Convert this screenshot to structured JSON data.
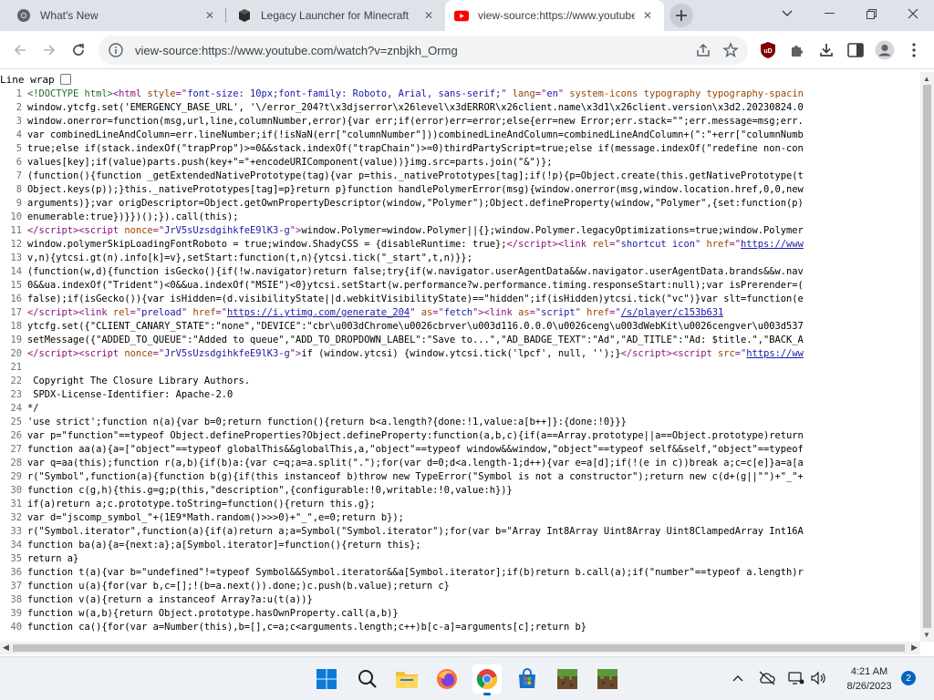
{
  "colors": {
    "accent": "#0067c0",
    "tabstrip": "#dee3ea",
    "source_text": "#000000",
    "tag": "#881280",
    "attr": "#994500",
    "value": "#1a1aa6",
    "comment": "#236e25"
  },
  "browser": {
    "tabs": [
      {
        "label": "What's New",
        "favicon": "chrome-logo-icon",
        "active": false
      },
      {
        "label": "Legacy Launcher for Minecraft",
        "favicon": "legacy-launcher-icon",
        "active": false
      },
      {
        "label": "view-source:https://www.youtube",
        "favicon": "youtube-logo-icon",
        "active": true
      }
    ],
    "address": "view-source:https://www.youtube.com/watch?v=znbjkh_Ormg"
  },
  "source_view": {
    "line_wrap_label": "Line wrap",
    "lines": [
      {
        "n": "1",
        "html": "<span class=\"t-comment\">&lt;!DOCTYPE html&gt;</span><span class=\"t-tag\">&lt;html </span><span class=\"t-attr\">style</span><span class=\"t-tag\">=\"</span><span class=\"t-val\">font-size: 10px;font-family: Roboto, Arial, sans-serif;</span><span class=\"t-tag\">\" </span><span class=\"t-attr\">lang</span><span class=\"t-tag\">=\"</span><span class=\"t-val\">en</span><span class=\"t-tag\">\" </span><span class=\"t-attr\">system-icons typography typography-spacin</span>"
      },
      {
        "n": "2",
        "text": "window.ytcfg.set('EMERGENCY_BASE_URL', '\\/error_204?t\\x3djserror\\x26level\\x3dERROR\\x26client.name\\x3d1\\x26client.version\\x3d2.20230824.0"
      },
      {
        "n": "3",
        "text": "window.onerror=function(msg,url,line,columnNumber,error){var err;if(error)err=error;else{err=new Error;err.stack=\"\";err.message=msg;err."
      },
      {
        "n": "4",
        "text": "var combinedLineAndColumn=err.lineNumber;if(!isNaN(err[\"columnNumber\"]))combinedLineAndColumn=combinedLineAndColumn+(\":\"+err[\"columnNumb"
      },
      {
        "n": "5",
        "text": "true;else if(stack.indexOf(\"trapProp\")>=0&&stack.indexOf(\"trapChain\")>=0)thirdPartyScript=true;else if(message.indexOf(\"redefine non-con"
      },
      {
        "n": "6",
        "text": "values[key];if(value)parts.push(key+\"=\"+encodeURIComponent(value))}img.src=parts.join(\"&\")};"
      },
      {
        "n": "7",
        "text": "(function(){function _getExtendedNativePrototype(tag){var p=this._nativePrototypes[tag];if(!p){p=Object.create(this.getNativePrototype(t"
      },
      {
        "n": "8",
        "text": "Object.keys(p));}this._nativePrototypes[tag]=p}return p}function handlePolymerError(msg){window.onerror(msg,window.location.href,0,0,new"
      },
      {
        "n": "9",
        "text": "arguments)};var origDescriptor=Object.getOwnPropertyDescriptor(window,\"Polymer\");Object.defineProperty(window,\"Polymer\",{set:function(p)"
      },
      {
        "n": "10",
        "text": "enumerable:true})}})();}).call(this);"
      },
      {
        "n": "11",
        "html": "<span class=\"t-tag\">&lt;/script&gt;&lt;script </span><span class=\"t-attr\">nonce</span><span class=\"t-tag\">=\"</span><span class=\"t-val\">JrV5sUzsdgihkfeE9lK3-g</span><span class=\"t-tag\">\"&gt;</span>window.Polymer=window.Polymer||{};window.Polymer.legacyOptimizations=true;window.Polymer"
      },
      {
        "n": "12",
        "html": "window.polymerSkipLoadingFontRoboto = true;window.ShadyCSS = {disableRuntime: true};<span class=\"t-tag\">&lt;/script&gt;&lt;link </span><span class=\"t-attr\">rel</span><span class=\"t-tag\">=\"</span><span class=\"t-val\">shortcut icon</span><span class=\"t-tag\">\" </span><span class=\"t-attr\">href</span><span class=\"t-tag\">=\"</span><span class=\"t-link\">https://www</span>"
      },
      {
        "n": "13",
        "text": "v,n){ytcsi.gt(n).info[k]=v},setStart:function(t,n){ytcsi.tick(\"_start\",t,n)}};"
      },
      {
        "n": "14",
        "text": "(function(w,d){function isGecko(){if(!w.navigator)return false;try{if(w.navigator.userAgentData&&w.navigator.userAgentData.brands&&w.nav"
      },
      {
        "n": "15",
        "text": "0&&ua.indexOf(\"Trident\")<0&&ua.indexOf(\"MSIE\")<0}ytcsi.setStart(w.performance?w.performance.timing.responseStart:null);var isPrerender=("
      },
      {
        "n": "16",
        "text": "false);if(isGecko()){var isHidden=(d.visibilityState||d.webkitVisibilityState)==\"hidden\";if(isHidden)ytcsi.tick(\"vc\")}var slt=function(e"
      },
      {
        "n": "17",
        "html": "<span class=\"t-tag\">&lt;/script&gt;&lt;link </span><span class=\"t-attr\">rel</span><span class=\"t-tag\">=\"</span><span class=\"t-val\">preload</span><span class=\"t-tag\">\" </span><span class=\"t-attr\">href</span><span class=\"t-tag\">=\"</span><span class=\"t-link\">https://i.ytimg.com/generate_204</span><span class=\"t-tag\">\" </span><span class=\"t-attr\">as</span><span class=\"t-tag\">=\"</span><span class=\"t-val\">fetch</span><span class=\"t-tag\">\"&gt;&lt;link </span><span class=\"t-attr\">as</span><span class=\"t-tag\">=\"</span><span class=\"t-val\">script</span><span class=\"t-tag\">\" </span><span class=\"t-attr\">href</span><span class=\"t-tag\">=\"</span><span class=\"t-link\">/s/player/c153b631</span>"
      },
      {
        "n": "18",
        "text": "ytcfg.set({\"CLIENT_CANARY_STATE\":\"none\",\"DEVICE\":\"cbr\\u003dChrome\\u0026cbrver\\u003d116.0.0.0\\u0026ceng\\u003dWebKit\\u0026cengver\\u003d537"
      },
      {
        "n": "19",
        "text": "setMessage({\"ADDED_TO_QUEUE\":\"Added to queue\",\"ADD_TO_DROPDOWN_LABEL\":\"Save to...\",\"AD_BADGE_TEXT\":\"Ad\",\"AD_TITLE\":\"Ad: $title.\",\"BACK_A"
      },
      {
        "n": "20",
        "html": "<span class=\"t-tag\">&lt;/script&gt;&lt;script </span><span class=\"t-attr\">nonce</span><span class=\"t-tag\">=\"</span><span class=\"t-val\">JrV5sUzsdgihkfeE9lK3-g</span><span class=\"t-tag\">\"&gt;</span>if (window.ytcsi) {window.ytcsi.tick('lpcf', null, '');}<span class=\"t-tag\">&lt;/script&gt;&lt;script </span><span class=\"t-attr\">src</span><span class=\"t-tag\">=\"</span><span class=\"t-link\">https://ww</span>"
      },
      {
        "n": "21",
        "text": ""
      },
      {
        "n": "22",
        "text": " Copyright The Closure Library Authors."
      },
      {
        "n": "23",
        "text": " SPDX-License-Identifier: Apache-2.0"
      },
      {
        "n": "24",
        "text": "*/"
      },
      {
        "n": "25",
        "text": "'use strict';function n(a){var b=0;return function(){return b<a.length?{done:!1,value:a[b++]}:{done:!0}}}"
      },
      {
        "n": "26",
        "text": "var p=\"function\"==typeof Object.defineProperties?Object.defineProperty:function(a,b,c){if(a==Array.prototype||a==Object.prototype)return"
      },
      {
        "n": "27",
        "text": "function aa(a){a=[\"object\"==typeof globalThis&&globalThis,a,\"object\"==typeof window&&window,\"object\"==typeof self&&self,\"object\"==typeof"
      },
      {
        "n": "28",
        "text": "var q=aa(this);function r(a,b){if(b)a:{var c=q;a=a.split(\".\");for(var d=0;d<a.length-1;d++){var e=a[d];if(!(e in c))break a;c=c[e]}a=a[a"
      },
      {
        "n": "29",
        "text": "r(\"Symbol\",function(a){function b(g){if(this instanceof b)throw new TypeError(\"Symbol is not a constructor\");return new c(d+(g||\"\")+\"_\"+"
      },
      {
        "n": "30",
        "text": "function c(g,h){this.g=g;p(this,\"description\",{configurable:!0,writable:!0,value:h})}"
      },
      {
        "n": "31",
        "text": "if(a)return a;c.prototype.toString=function(){return this.g};"
      },
      {
        "n": "32",
        "text": "var d=\"jscomp_symbol_\"+(1E9*Math.random()>>>0)+\"_\",e=0;return b});"
      },
      {
        "n": "33",
        "text": "r(\"Symbol.iterator\",function(a){if(a)return a;a=Symbol(\"Symbol.iterator\");for(var b=\"Array Int8Array Uint8Array Uint8ClampedArray Int16A"
      },
      {
        "n": "34",
        "text": "function ba(a){a={next:a};a[Symbol.iterator]=function(){return this};"
      },
      {
        "n": "35",
        "text": "return a}"
      },
      {
        "n": "36",
        "text": "function t(a){var b=\"undefined\"!=typeof Symbol&&Symbol.iterator&&a[Symbol.iterator];if(b)return b.call(a);if(\"number\"==typeof a.length)r"
      },
      {
        "n": "37",
        "text": "function u(a){for(var b,c=[];!(b=a.next()).done;)c.push(b.value);return c}"
      },
      {
        "n": "38",
        "text": "function v(a){return a instanceof Array?a:u(t(a))}"
      },
      {
        "n": "39",
        "text": "function w(a,b){return Object.prototype.hasOwnProperty.call(a,b)}"
      },
      {
        "n": "40",
        "text": "function ca(){for(var a=Number(this),b=[],c=a;c<arguments.length;c++)b[c-a]=arguments[c];return b}"
      }
    ]
  },
  "taskbar": {
    "apps": [
      {
        "name": "start-button",
        "icon": "windows-logo-icon"
      },
      {
        "name": "search-button",
        "icon": "search-icon"
      },
      {
        "name": "file-explorer-app",
        "icon": "folder-icon"
      },
      {
        "name": "firefox-app",
        "icon": "firefox-icon"
      },
      {
        "name": "chrome-app",
        "icon": "chrome-icon",
        "active": true
      },
      {
        "name": "microsoft-store-app",
        "icon": "store-icon"
      },
      {
        "name": "minecraft-app-1",
        "icon": "minecraft-block-icon"
      },
      {
        "name": "minecraft-app-2",
        "icon": "minecraft-block-icon"
      }
    ],
    "time": "4:21 AM",
    "date": "8/26/2023",
    "notification_count": "2"
  }
}
